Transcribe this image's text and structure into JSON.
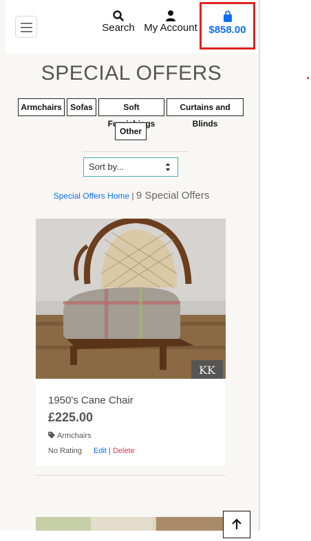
{
  "header": {
    "menu_icon": "hamburger-icon",
    "search_label": "Search",
    "account_label": "My Account",
    "cart_total": "$858.00",
    "accent_color": "#0d6efd",
    "highlight_color": "#e0211d"
  },
  "page": {
    "title": "SPECIAL OFFERS"
  },
  "categories": [
    {
      "label": "Armchairs"
    },
    {
      "label": "Sofas"
    },
    {
      "label": "Soft Furnishings"
    },
    {
      "label": "Curtains and Blinds"
    },
    {
      "label": "Other"
    }
  ],
  "sort": {
    "selected": "Sort by..."
  },
  "breadcrumb": {
    "home_link": "Special Offers Home",
    "separator": "|",
    "count_text": "9 Special Offers"
  },
  "products": [
    {
      "name": "1950's Cane Chair",
      "price": "£225.00",
      "category": "Armchairs",
      "rating": "No Rating",
      "edit_label": "Edit",
      "separator": "|",
      "delete_label": "Delete",
      "image_badge": "KK"
    }
  ],
  "back_to_top_icon": "arrow-up-icon"
}
